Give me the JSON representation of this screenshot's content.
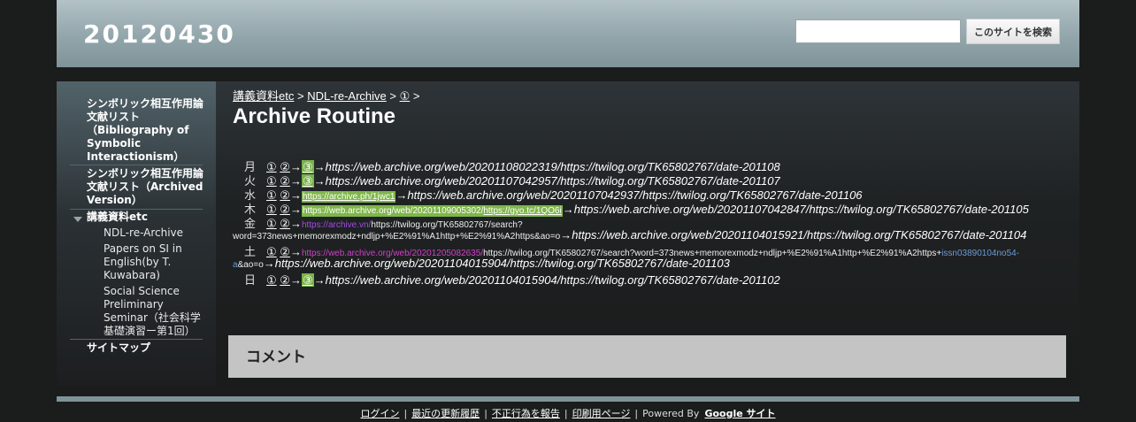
{
  "header": {
    "site_title": "20120430",
    "search_placeholder": "",
    "search_button": "このサイトを検索"
  },
  "sidebar": {
    "items": [
      {
        "label": "シンボリック相互作用論文献リスト（Bibliography of Symbolic Interactionism）"
      },
      {
        "label": "シンボリック相互作用論文献リスト（Archived Version）"
      },
      {
        "label": "講義資料etc"
      },
      {
        "label": "NDL-re-Archive"
      },
      {
        "label": "Papers on SI in English(by T. Kuwabara)"
      },
      {
        "label": "Social Science Preliminary Seminar（社会科学基礎演習ー第1回）"
      },
      {
        "label": "サイトマップ"
      }
    ]
  },
  "breadcrumb": {
    "crumb1": "講義資料etc",
    "crumb2": "NDL-re-Archive",
    "crumb3": "①",
    "sep": ">"
  },
  "page_title": "Archive Routine",
  "rows": {
    "mon": {
      "day": "月",
      "a": "①",
      "b": "②",
      "c": "③",
      "arrow": "→",
      "url": "https://web.archive.org/web/20201108022319/https://twilog.org/TK65802767/date-201108"
    },
    "tue": {
      "day": "火",
      "a": "①",
      "b": "②",
      "c": "③",
      "arrow": "→",
      "url": "https://web.archive.org/web/20201107042957/https://twilog.org/TK65802767/date-201107"
    },
    "wed": {
      "day": "水",
      "a": "①",
      "b": "②",
      "box": "https://archive.ph/1jwc1",
      "arrow": "→",
      "url": "https://web.archive.org/web/20201107042937/https://twilog.org/TK65802767/date-201106"
    },
    "thu": {
      "day": "木",
      "a": "①",
      "b": "②",
      "box1": "https://web.archive.org/web/20201109005302/",
      "box2": "https://gyo.tc/1QO6i",
      "arrow": "→",
      "url": "https://web.archive.org/web/20201107042847/https://twilog.org/TK65802767/date-201105"
    },
    "fri": {
      "day": "金",
      "a": "①",
      "b": "②",
      "arrow": "→",
      "purple": "https://archive.vn/",
      "small1": "https://twilog.org/TK65802767/search?",
      "small2": "word=373news+memorexmodz+ndljp+%E2%91%A1http+%E2%91%A2https&ao=o",
      "url": "https://web.archive.org/web/20201104015921/https://twilog.org/TK65802767/date-201104"
    },
    "sat": {
      "day": "土",
      "a": "①",
      "b": "②",
      "arrow": "→",
      "magenta": "https://web.archive.org/web/20201205082635/",
      "small1": "https://twilog.org/TK65802767/search?word=373news+memorexmodz+ndljp+%E2%91%A1http+%E2%91%A2https+",
      "blue1": "issn03890104no54-",
      "blue2": "a",
      "small2": "&ao=o",
      "url": "https://web.archive.org/web/20201104015904/https://twilog.org/TK65802767/date-201103"
    },
    "sun": {
      "day": "日",
      "a": "①",
      "b": "②",
      "c": "③",
      "arrow": "→",
      "url": "https://web.archive.org/web/20201104015904/https://twilog.org/TK65802767/date-201102"
    }
  },
  "comments": {
    "title": "コメント"
  },
  "footer": {
    "login": "ログイン",
    "recent": "最近の更新履歴",
    "report": "不正行為を報告",
    "print": "印刷用ページ",
    "powered": "Powered By",
    "google": "Google サイト",
    "sep": "|"
  }
}
